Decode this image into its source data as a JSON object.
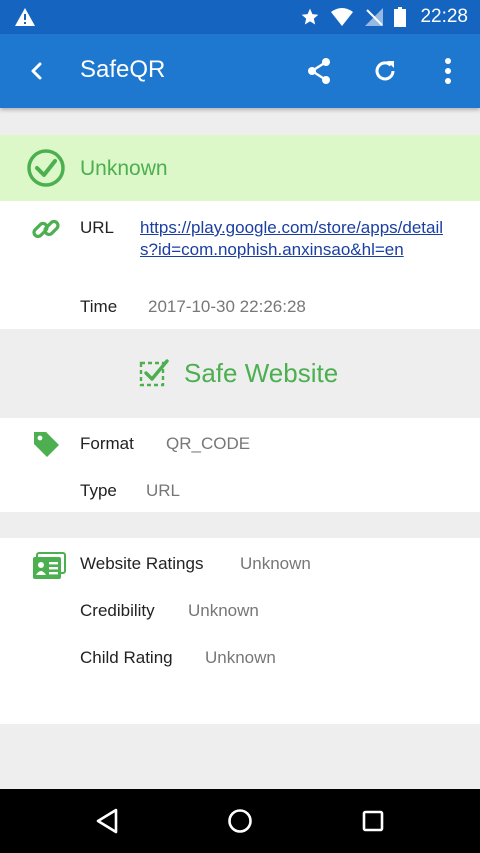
{
  "status_bar": {
    "time": "22:28"
  },
  "app_bar": {
    "title": "SafeQR"
  },
  "banner": {
    "status": "Unknown"
  },
  "url_section": {
    "url_label": "URL",
    "url_value": "https://play.google.com/store/apps/details?id=com.nophish.anxinsao&hl=en",
    "time_label": "Time",
    "time_value": "2017-10-30 22:26:28"
  },
  "safety": {
    "label": "Safe Website"
  },
  "code_section": {
    "format_label": "Format",
    "format_value": "QR_CODE",
    "type_label": "Type",
    "type_value": "URL"
  },
  "ratings_section": {
    "website_ratings_label": "Website Ratings",
    "website_ratings_value": "Unknown",
    "credibility_label": "Credibility",
    "credibility_value": "Unknown",
    "child_rating_label": "Child Rating",
    "child_rating_value": "Unknown"
  },
  "colors": {
    "primary": "#1e78d0",
    "status_bar": "#1565c0",
    "success_green": "#4caf50",
    "banner_bg": "#dcf7c8",
    "link": "#1a3fa0"
  },
  "icons": [
    "warning-icon",
    "star-icon",
    "wifi-icon",
    "no-sim-icon",
    "battery-icon",
    "back-arrow-icon",
    "share-icon",
    "refresh-icon",
    "more-vert-icon",
    "check-circle-icon",
    "link-icon",
    "verified-check-icon",
    "tag-icon",
    "id-card-icon",
    "nav-back-icon",
    "nav-home-icon",
    "nav-recents-icon"
  ]
}
